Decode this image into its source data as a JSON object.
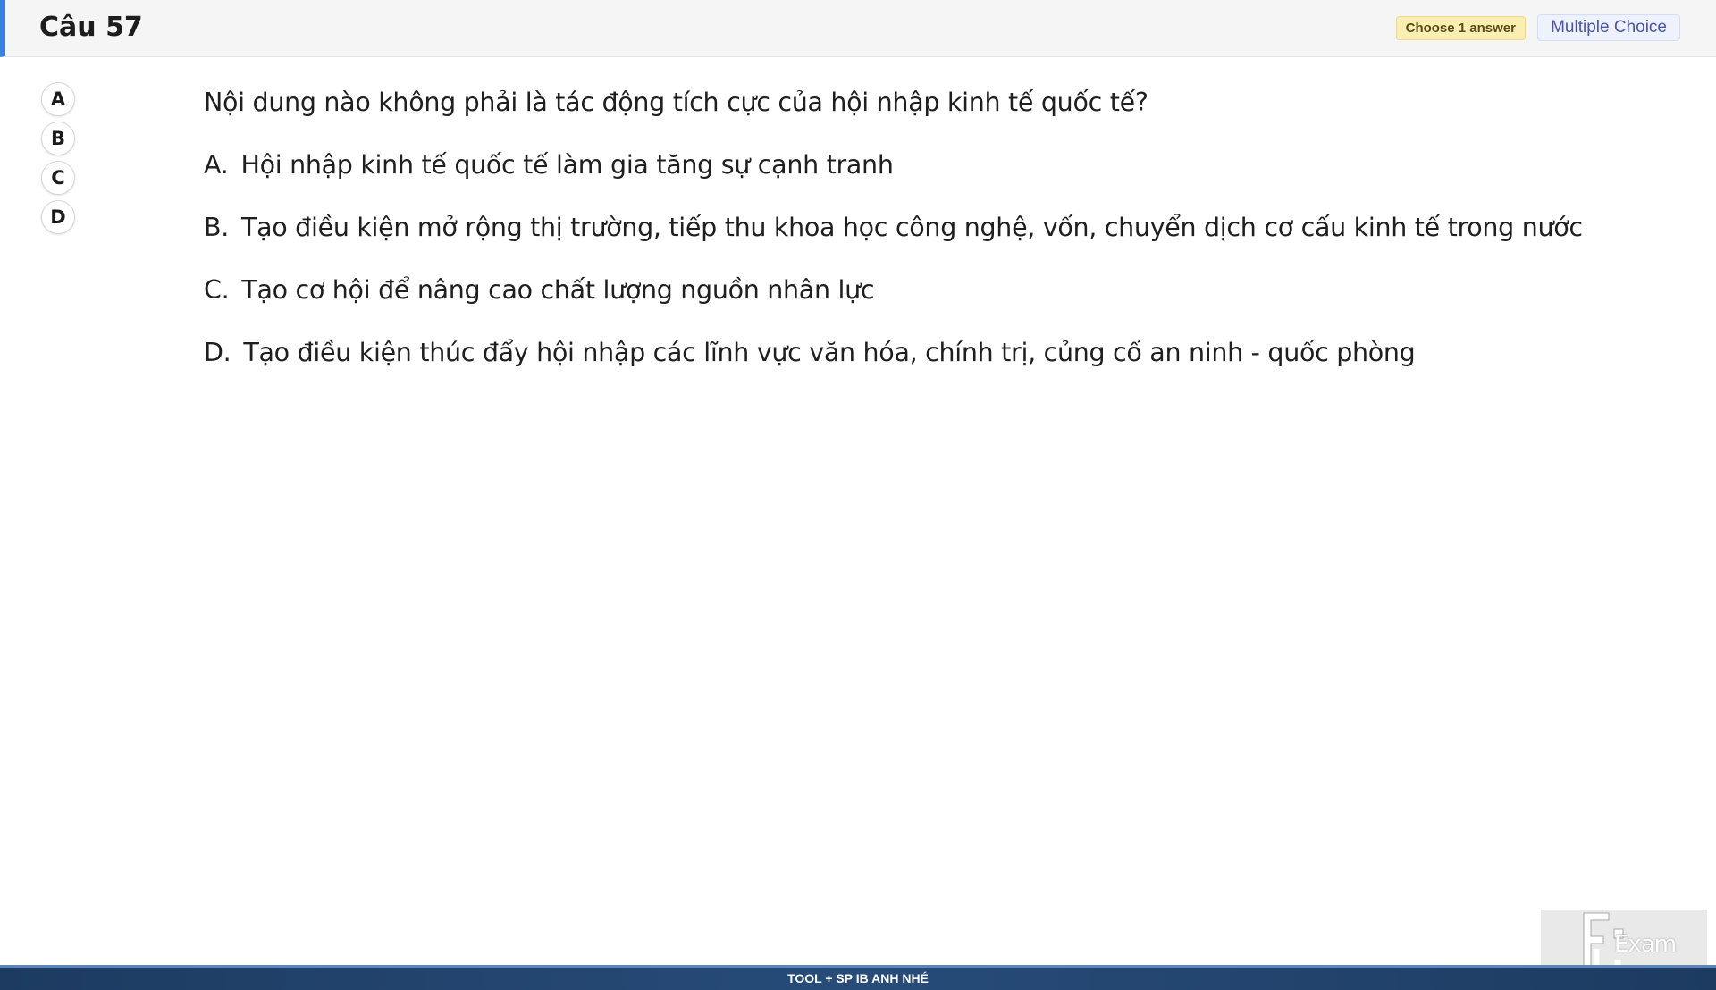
{
  "header": {
    "title": "Câu 57",
    "badge_choose": "Choose 1 answer",
    "badge_type": "Multiple Choice",
    "accent_color": "#3d7fe0"
  },
  "choices": [
    "A",
    "B",
    "C",
    "D"
  ],
  "question": {
    "text": "Nội dung nào không phải là tác động tích cực của hội nhập kinh tế quốc tế?",
    "options": [
      {
        "letter": "A.",
        "text": "Hội nhập kinh tế quốc tế làm gia tăng sự cạnh tranh"
      },
      {
        "letter": "B.",
        "text": "Tạo điều kiện mở rộng thị trường, tiếp thu khoa học công nghệ, vốn, chuyển dịch cơ cấu kinh tế trong nước"
      },
      {
        "letter": "C.",
        "text": "Tạo cơ hội để nâng cao chất lượng nguồn nhân lực"
      },
      {
        "letter": "D.",
        "text": "Tạo điều kiện thúc đẩy hội nhập các lĩnh vực văn hóa, chính trị, củng cố an ninh - quốc phòng"
      }
    ]
  },
  "footer": {
    "text": "TOOL + SP IB ANH NHÉ"
  },
  "logo": {
    "icon": "fu-exam-logo-icon",
    "word": "Exam"
  }
}
